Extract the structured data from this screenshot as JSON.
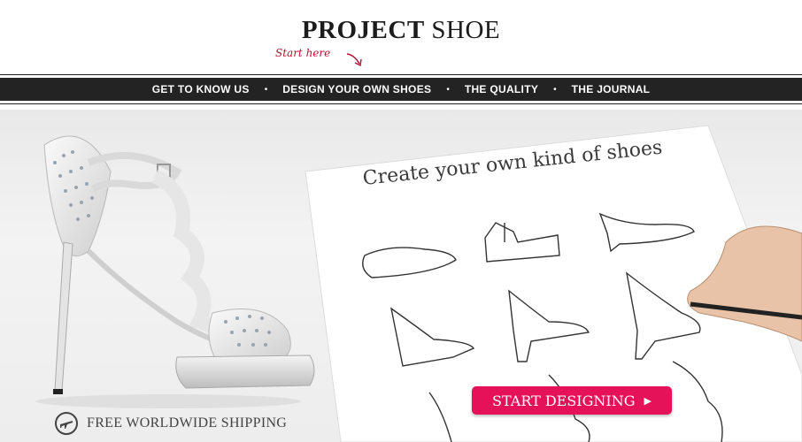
{
  "header": {
    "logo_bold": "PROJECT",
    "logo_light": "SHOE",
    "tagline": "Start here"
  },
  "nav": {
    "items": [
      {
        "label": "GET TO KNOW US"
      },
      {
        "label": "DESIGN YOUR OWN SHOES"
      },
      {
        "label": "THE QUALITY"
      },
      {
        "label": "THE JOURNAL"
      }
    ],
    "separator": "•"
  },
  "hero": {
    "paper_title": "Create your own kind of shoes",
    "cta_label": "START DESIGNING",
    "cta_arrow": "▶",
    "shipping_text": "FREE WORLDWIDE SHIPPING",
    "shipping_icon": "airplane-icon"
  },
  "colors": {
    "nav_bg": "#232323",
    "cta_bg": "#e5125a",
    "accent_red": "#b3122f"
  }
}
